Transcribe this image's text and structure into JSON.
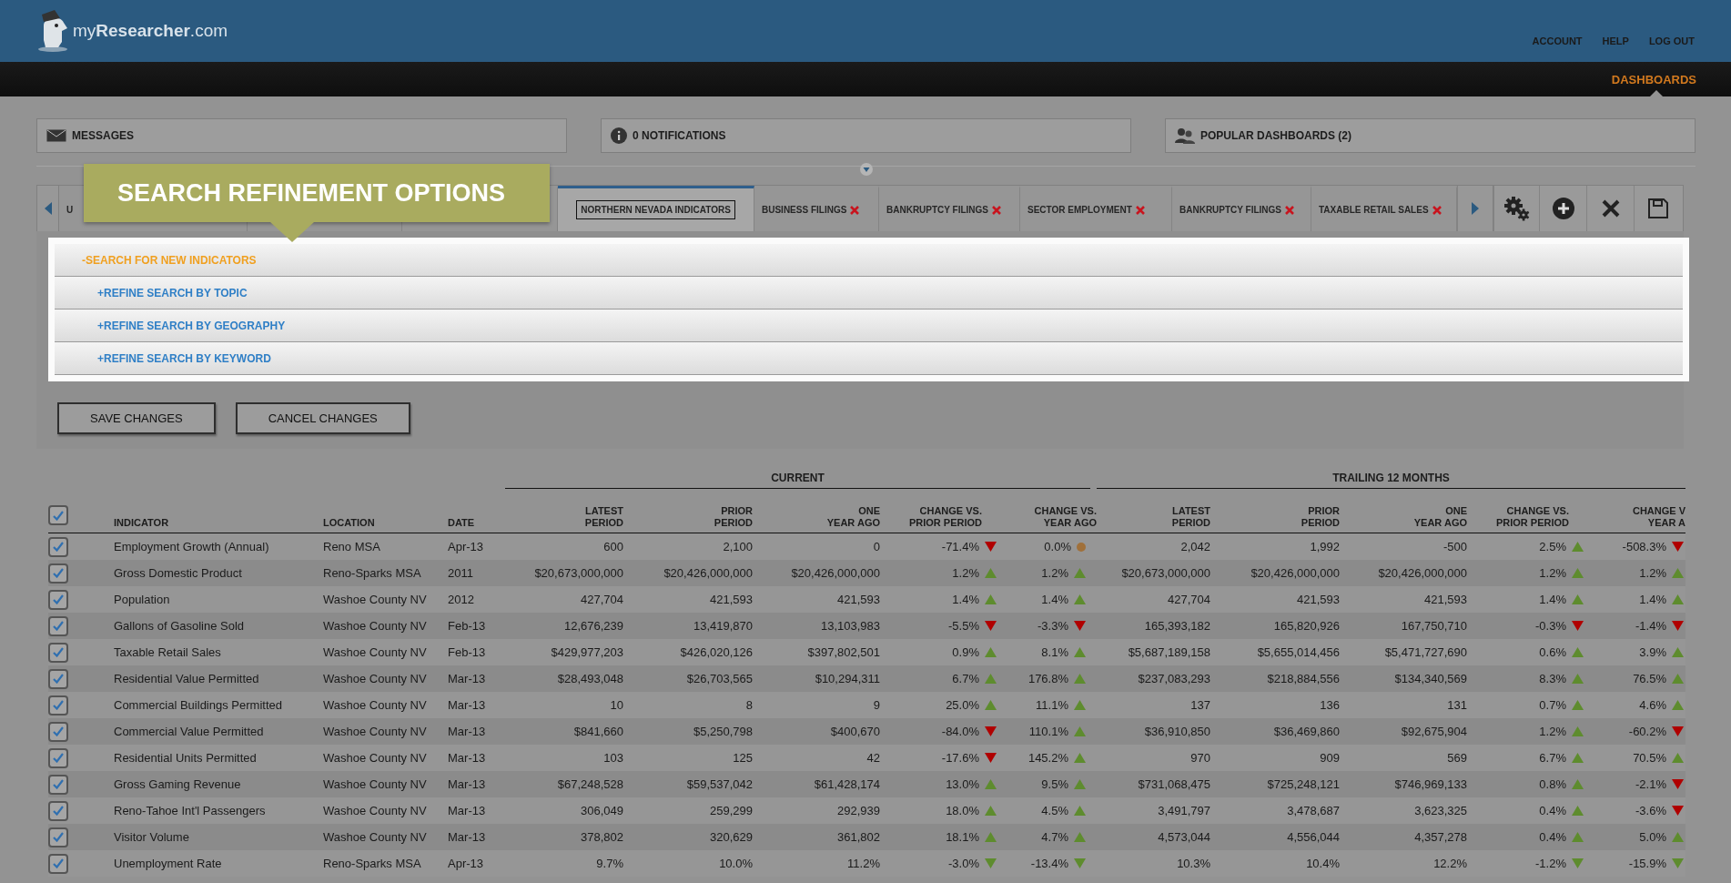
{
  "header": {
    "logo_text": "my**Researcher**.com",
    "nav": [
      "ACCOUNT",
      "HELP",
      "LOG OUT"
    ]
  },
  "main_nav": [
    {
      "label": "DASHBOARDS",
      "selected": true
    }
  ],
  "panels": [
    {
      "kind": "messages",
      "label": "MESSAGES"
    },
    {
      "kind": "notifications",
      "label": "0 NOTIFICATIONS"
    },
    {
      "kind": "people",
      "label": "POPULAR DASHBOARDS (2)"
    }
  ],
  "callout": "SEARCH REFINEMENT OPTIONS",
  "tabs": [
    {
      "label": "U",
      "selected": false,
      "closable": false
    },
    {
      "selected": false,
      "closable": false
    },
    {
      "selected": false,
      "closable": false
    },
    {
      "label": "NORTHERN NEVADA INDICATORS",
      "selected": true,
      "closable": false
    },
    {
      "label": "BUSINESS FILINGS",
      "selected": false,
      "closable": true
    },
    {
      "label": "BANKRUPTCY FILINGS",
      "selected": false,
      "closable": true
    },
    {
      "label": "SECTOR EMPLOYMENT",
      "selected": false,
      "closable": true
    },
    {
      "label": "BANKRUPTCY FILINGS",
      "selected": false,
      "closable": true
    },
    {
      "label": "TAXABLE RETAIL SALES",
      "selected": false,
      "closable": true
    }
  ],
  "tab_tools": [
    {
      "kind": "settings"
    },
    {
      "kind": "add"
    },
    {
      "kind": "close"
    },
    {
      "kind": "save"
    }
  ],
  "search_panel": [
    {
      "sign": "-",
      "label": "SEARCH FOR NEW INDICATORS",
      "expanded": true,
      "children": [
        {
          "sign": "+",
          "label": "REFINE SEARCH BY TOPIC",
          "expanded": false
        },
        {
          "sign": "+",
          "label": "REFINE SEARCH BY GEOGRAPHY",
          "expanded": false
        },
        {
          "sign": "+",
          "label": "REFINE SEARCH BY KEYWORD",
          "expanded": false
        }
      ]
    }
  ],
  "buttons": [
    "SAVE CHANGES",
    "CANCEL CHANGES"
  ],
  "table": {
    "groups": [
      "CURRENT",
      "TRAILING 12 MONTHS"
    ],
    "all_checked": true,
    "columns": [
      [
        "INDICATOR"
      ],
      [
        "LOCATION"
      ],
      [
        "DATE"
      ],
      [
        "LATEST",
        "PERIOD"
      ],
      [
        "PRIOR",
        "PERIOD"
      ],
      [
        "ONE",
        "YEAR AGO"
      ],
      [
        "CHANGE VS.",
        "PRIOR PERIOD"
      ],
      [
        "CHANGE VS.",
        "YEAR AGO"
      ],
      [
        "LATEST",
        "PERIOD"
      ],
      [
        "PRIOR",
        "PERIOD"
      ],
      [
        "ONE",
        "YEAR AGO"
      ],
      [
        "CHANGE VS.",
        "PRIOR PERIOD"
      ],
      [
        "CHANGE V",
        "YEAR A"
      ]
    ],
    "rows": [
      {
        "checked": true,
        "indicator": "Employment Growth (Annual)",
        "location": "Reno MSA",
        "date": "Apr-13",
        "current": [
          "600",
          "2,100",
          "0"
        ],
        "current_change": [
          {
            "value": "-71.4%",
            "kind": "down",
            "color": "#b00000"
          },
          {
            "value": "0.0%",
            "kind": "flat",
            "color": "#a0703a"
          }
        ],
        "trailing": [
          "2,042",
          "1,992",
          "-500"
        ],
        "trailing_change": [
          {
            "value": "2.5%",
            "kind": "up",
            "color": "#5e8c2e"
          },
          {
            "value": "-508.3%",
            "kind": "down",
            "color": "#b00000"
          }
        ]
      },
      {
        "checked": true,
        "indicator": "Gross Domestic Product",
        "location": "Reno-Sparks MSA",
        "date": "2011",
        "current": [
          "$20,673,000,000",
          "$20,426,000,000",
          "$20,426,000,000"
        ],
        "current_change": [
          {
            "value": "1.2%",
            "kind": "up",
            "color": "#5e8c2e"
          },
          {
            "value": "1.2%",
            "kind": "up",
            "color": "#5e8c2e"
          }
        ],
        "trailing": [
          "$20,673,000,000",
          "$20,426,000,000",
          "$20,426,000,000"
        ],
        "trailing_change": [
          {
            "value": "1.2%",
            "kind": "up",
            "color": "#5e8c2e"
          },
          {
            "value": "1.2%",
            "kind": "up",
            "color": "#5e8c2e"
          }
        ]
      },
      {
        "checked": true,
        "indicator": "Population",
        "location": "Washoe County NV",
        "date": "2012",
        "current": [
          "427,704",
          "421,593",
          "421,593"
        ],
        "current_change": [
          {
            "value": "1.4%",
            "kind": "up",
            "color": "#5e8c2e"
          },
          {
            "value": "1.4%",
            "kind": "up",
            "color": "#5e8c2e"
          }
        ],
        "trailing": [
          "427,704",
          "421,593",
          "421,593"
        ],
        "trailing_change": [
          {
            "value": "1.4%",
            "kind": "up",
            "color": "#5e8c2e"
          },
          {
            "value": "1.4%",
            "kind": "up",
            "color": "#5e8c2e"
          }
        ]
      },
      {
        "checked": true,
        "indicator": "Gallons of Gasoline Sold",
        "location": "Washoe County NV",
        "date": "Feb-13",
        "current": [
          "12,676,239",
          "13,419,870",
          "13,103,983"
        ],
        "current_change": [
          {
            "value": "-5.5%",
            "kind": "down",
            "color": "#b00000"
          },
          {
            "value": "-3.3%",
            "kind": "down",
            "color": "#b00000"
          }
        ],
        "trailing": [
          "165,393,182",
          "165,820,926",
          "167,750,710"
        ],
        "trailing_change": [
          {
            "value": "-0.3%",
            "kind": "down",
            "color": "#b00000"
          },
          {
            "value": "-1.4%",
            "kind": "down",
            "color": "#b00000"
          }
        ]
      },
      {
        "checked": true,
        "indicator": "Taxable Retail Sales",
        "location": "Washoe County NV",
        "date": "Feb-13",
        "current": [
          "$429,977,203",
          "$426,020,126",
          "$397,802,501"
        ],
        "current_change": [
          {
            "value": "0.9%",
            "kind": "up",
            "color": "#5e8c2e"
          },
          {
            "value": "8.1%",
            "kind": "up",
            "color": "#5e8c2e"
          }
        ],
        "trailing": [
          "$5,687,189,158",
          "$5,655,014,456",
          "$5,471,727,690"
        ],
        "trailing_change": [
          {
            "value": "0.6%",
            "kind": "up",
            "color": "#5e8c2e"
          },
          {
            "value": "3.9%",
            "kind": "up",
            "color": "#5e8c2e"
          }
        ]
      },
      {
        "checked": true,
        "indicator": "Residential Value Permitted",
        "location": "Washoe County NV",
        "date": "Mar-13",
        "current": [
          "$28,493,048",
          "$26,703,565",
          "$10,294,311"
        ],
        "current_change": [
          {
            "value": "6.7%",
            "kind": "up",
            "color": "#5e8c2e"
          },
          {
            "value": "176.8%",
            "kind": "up",
            "color": "#5e8c2e"
          }
        ],
        "trailing": [
          "$237,083,293",
          "$218,884,556",
          "$134,340,569"
        ],
        "trailing_change": [
          {
            "value": "8.3%",
            "kind": "up",
            "color": "#5e8c2e"
          },
          {
            "value": "76.5%",
            "kind": "up",
            "color": "#5e8c2e"
          }
        ]
      },
      {
        "checked": true,
        "indicator": "Commercial Buildings Permitted",
        "location": "Washoe County NV",
        "date": "Mar-13",
        "current": [
          "10",
          "8",
          "9"
        ],
        "current_change": [
          {
            "value": "25.0%",
            "kind": "up",
            "color": "#5e8c2e"
          },
          {
            "value": "11.1%",
            "kind": "up",
            "color": "#5e8c2e"
          }
        ],
        "trailing": [
          "137",
          "136",
          "131"
        ],
        "trailing_change": [
          {
            "value": "0.7%",
            "kind": "up",
            "color": "#5e8c2e"
          },
          {
            "value": "4.6%",
            "kind": "up",
            "color": "#5e8c2e"
          }
        ]
      },
      {
        "checked": true,
        "indicator": "Commercial Value Permitted",
        "location": "Washoe County NV",
        "date": "Mar-13",
        "current": [
          "$841,660",
          "$5,250,798",
          "$400,670"
        ],
        "current_change": [
          {
            "value": "-84.0%",
            "kind": "down",
            "color": "#b00000"
          },
          {
            "value": "110.1%",
            "kind": "up",
            "color": "#5e8c2e"
          }
        ],
        "trailing": [
          "$36,910,850",
          "$36,469,860",
          "$92,675,904"
        ],
        "trailing_change": [
          {
            "value": "1.2%",
            "kind": "up",
            "color": "#5e8c2e"
          },
          {
            "value": "-60.2%",
            "kind": "down",
            "color": "#b00000"
          }
        ]
      },
      {
        "checked": true,
        "indicator": "Residential Units Permitted",
        "location": "Washoe County NV",
        "date": "Mar-13",
        "current": [
          "103",
          "125",
          "42"
        ],
        "current_change": [
          {
            "value": "-17.6%",
            "kind": "down",
            "color": "#b00000"
          },
          {
            "value": "145.2%",
            "kind": "up",
            "color": "#5e8c2e"
          }
        ],
        "trailing": [
          "970",
          "909",
          "569"
        ],
        "trailing_change": [
          {
            "value": "6.7%",
            "kind": "up",
            "color": "#5e8c2e"
          },
          {
            "value": "70.5%",
            "kind": "up",
            "color": "#5e8c2e"
          }
        ]
      },
      {
        "checked": true,
        "indicator": "Gross Gaming Revenue",
        "location": "Washoe County NV",
        "date": "Mar-13",
        "current": [
          "$67,248,528",
          "$59,537,042",
          "$61,428,174"
        ],
        "current_change": [
          {
            "value": "13.0%",
            "kind": "up",
            "color": "#5e8c2e"
          },
          {
            "value": "9.5%",
            "kind": "up",
            "color": "#5e8c2e"
          }
        ],
        "trailing": [
          "$731,068,475",
          "$725,248,121",
          "$746,969,133"
        ],
        "trailing_change": [
          {
            "value": "0.8%",
            "kind": "up",
            "color": "#5e8c2e"
          },
          {
            "value": "-2.1%",
            "kind": "down",
            "color": "#b00000"
          }
        ]
      },
      {
        "checked": true,
        "indicator": "Reno-Tahoe Int'l Passengers",
        "location": "Washoe County NV",
        "date": "Mar-13",
        "current": [
          "306,049",
          "259,299",
          "292,939"
        ],
        "current_change": [
          {
            "value": "18.0%",
            "kind": "up",
            "color": "#5e8c2e"
          },
          {
            "value": "4.5%",
            "kind": "up",
            "color": "#5e8c2e"
          }
        ],
        "trailing": [
          "3,491,797",
          "3,478,687",
          "3,623,325"
        ],
        "trailing_change": [
          {
            "value": "0.4%",
            "kind": "up",
            "color": "#5e8c2e"
          },
          {
            "value": "-3.6%",
            "kind": "down",
            "color": "#b00000"
          }
        ]
      },
      {
        "checked": true,
        "indicator": "Visitor Volume",
        "location": "Washoe County NV",
        "date": "Mar-13",
        "current": [
          "378,802",
          "320,629",
          "361,802"
        ],
        "current_change": [
          {
            "value": "18.1%",
            "kind": "up",
            "color": "#5e8c2e"
          },
          {
            "value": "4.7%",
            "kind": "up",
            "color": "#5e8c2e"
          }
        ],
        "trailing": [
          "4,573,044",
          "4,556,044",
          "4,357,278"
        ],
        "trailing_change": [
          {
            "value": "0.4%",
            "kind": "up",
            "color": "#5e8c2e"
          },
          {
            "value": "5.0%",
            "kind": "up",
            "color": "#5e8c2e"
          }
        ]
      },
      {
        "checked": true,
        "indicator": "Unemployment Rate",
        "location": "Reno-Sparks MSA",
        "date": "Apr-13",
        "current": [
          "9.7%",
          "10.0%",
          "11.2%"
        ],
        "current_change": [
          {
            "value": "-3.0%",
            "kind": "down",
            "color": "#5e8c2e"
          },
          {
            "value": "-13.4%",
            "kind": "down",
            "color": "#5e8c2e"
          }
        ],
        "trailing": [
          "10.3%",
          "10.4%",
          "12.2%"
        ],
        "trailing_change": [
          {
            "value": "-1.2%",
            "kind": "down",
            "color": "#5e8c2e"
          },
          {
            "value": "-15.9%",
            "kind": "down",
            "color": "#5e8c2e"
          }
        ]
      }
    ]
  }
}
